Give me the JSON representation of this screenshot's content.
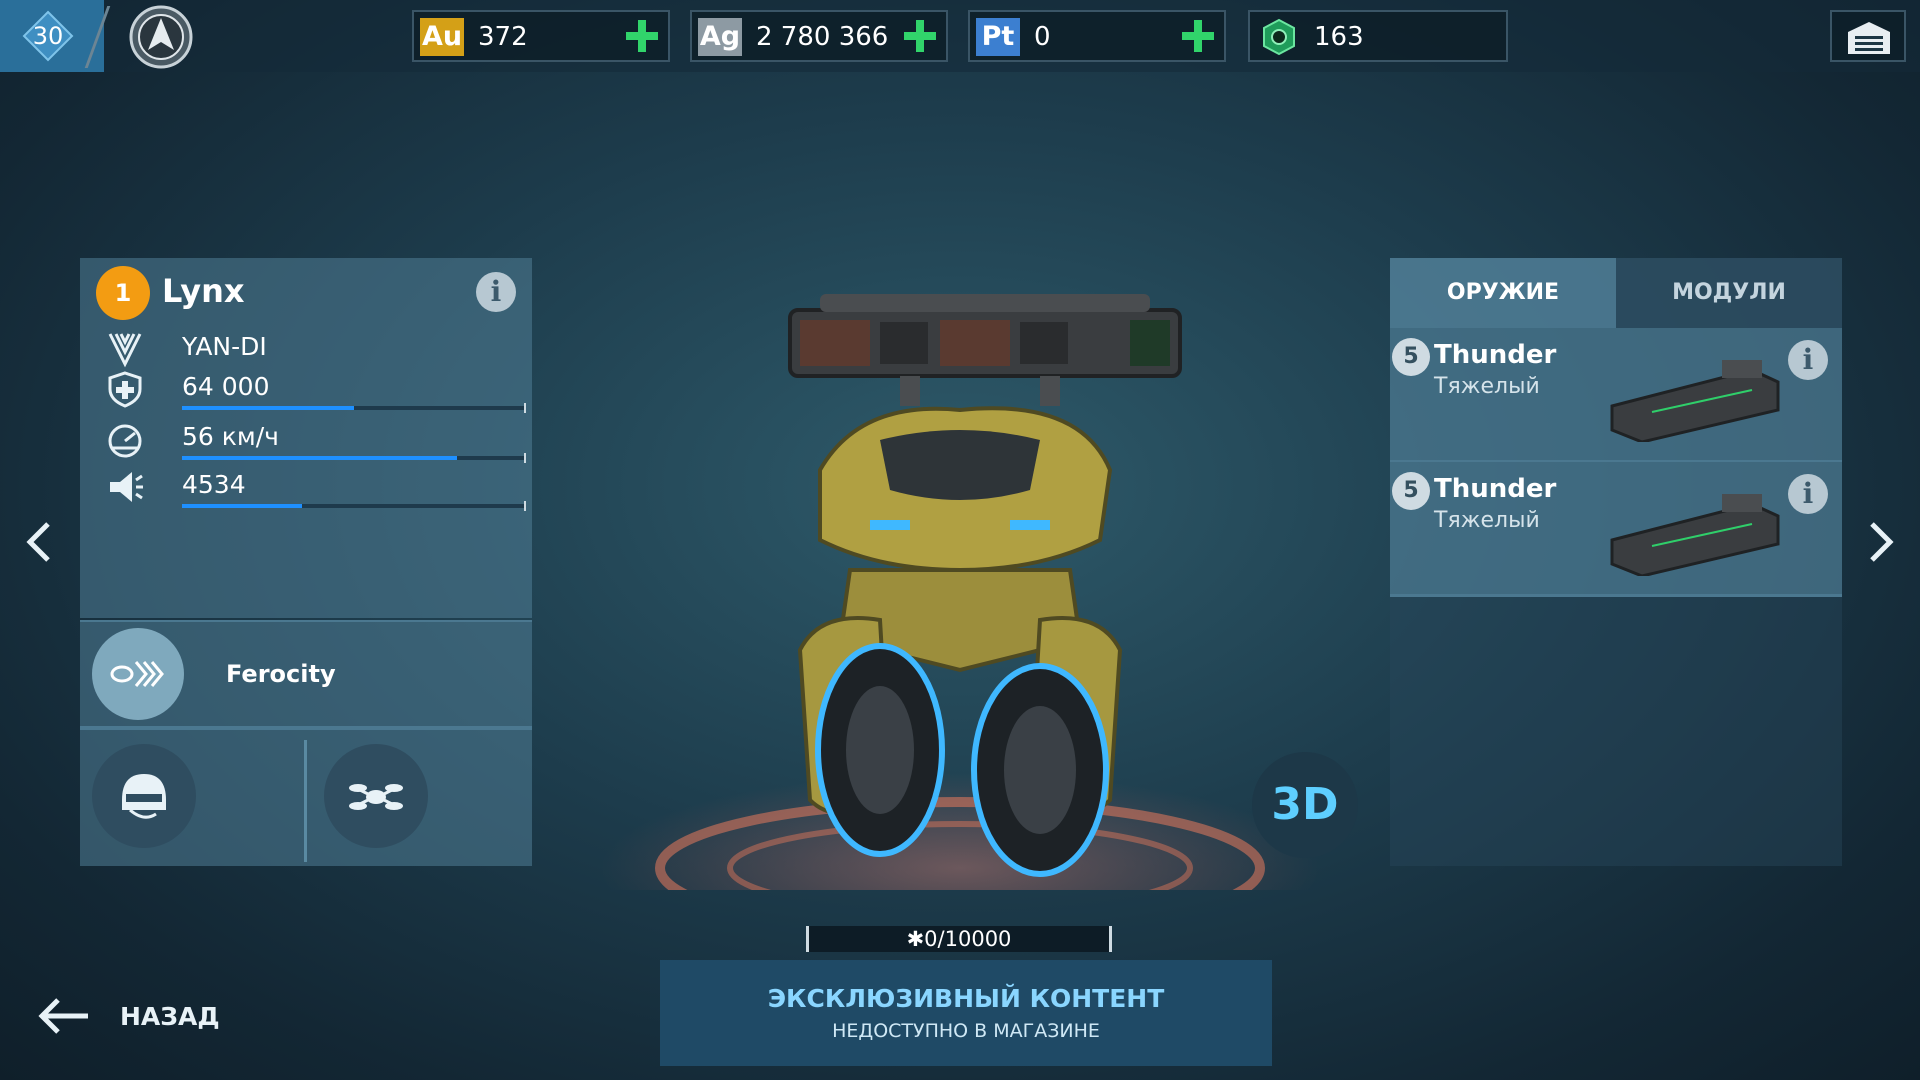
{
  "topbar": {
    "level": "30",
    "currencies": [
      {
        "tag": "Au",
        "value": "372",
        "color": "#d4a017"
      },
      {
        "tag": "Ag",
        "value": "2 780 366",
        "color": "#8d9aa3"
      },
      {
        "tag": "Pt",
        "value": "0",
        "color": "#3c7fd0"
      },
      {
        "tag": "",
        "value": "163",
        "color": "#2ecc71"
      }
    ]
  },
  "robot": {
    "tier": "1",
    "name": "Lynx",
    "manufacturer": "YAN-DI",
    "durability": "64 000",
    "durability_fraction": 0.5,
    "speed": "56 км/ч",
    "speed_fraction": 0.8,
    "damage": "4534",
    "damage_fraction": 0.35,
    "ability": "Ferocity"
  },
  "tabs": {
    "weapons": "ОРУЖИЕ",
    "modules": "МОДУЛИ"
  },
  "weapons": [
    {
      "level": "5",
      "name": "Thunder",
      "type": "Тяжелый"
    },
    {
      "level": "5",
      "name": "Thunder",
      "type": "Тяжелый"
    }
  ],
  "view3d": "3D",
  "progress": "0/10000",
  "exclusive": {
    "title": "ЭКСКЛЮЗИВНЫЙ КОНТЕНТ",
    "subtitle": "НЕДОСТУПНО В МАГАЗИНЕ"
  },
  "back_label": "НАЗАД",
  "icons": {
    "info": "info-icon",
    "faction": "yandi-faction-icon",
    "shield": "shield-icon",
    "speed": "speedometer-icon",
    "damage": "damage-icon",
    "ability": "ferocity-ability-icon",
    "pilot": "pilot-helmet-icon",
    "drone": "drone-icon",
    "hangar": "hangar-icon",
    "back": "arrow-left-icon",
    "prev": "chevron-left-icon",
    "next": "chevron-right-icon"
  },
  "info_glyph": "i"
}
